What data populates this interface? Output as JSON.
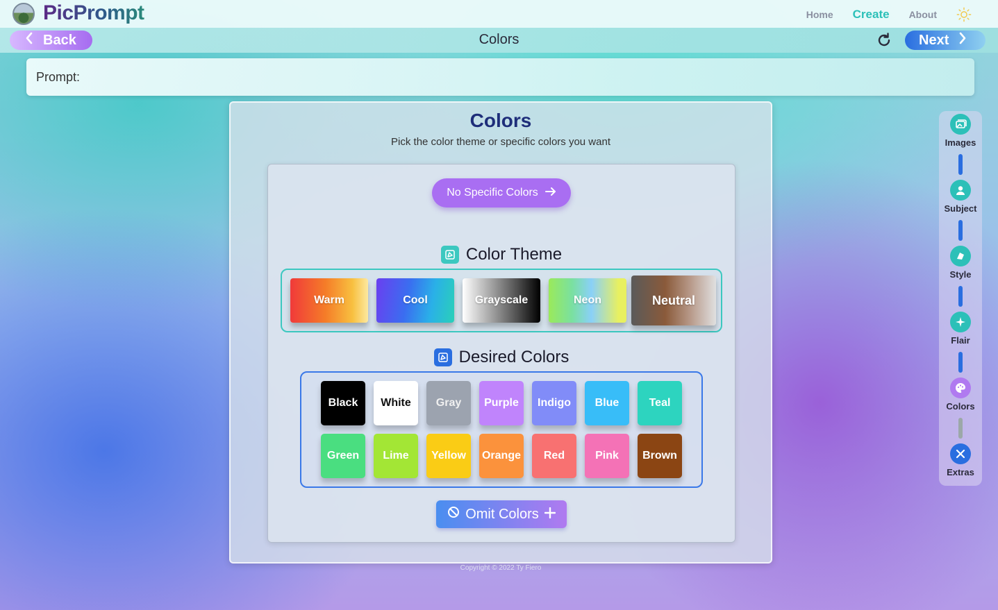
{
  "header": {
    "app_name": "PicPrompt",
    "nav": [
      "Home",
      "Create",
      "About"
    ]
  },
  "toolbar": {
    "back_label": "Back",
    "title": "Colors",
    "next_label": "Next"
  },
  "prompt": {
    "label": "Prompt:"
  },
  "panel": {
    "title": "Colors",
    "subtitle": "Pick the color theme or specific colors you want",
    "no_specific_label": "No Specific Colors",
    "theme_heading": "Color Theme",
    "themes": [
      "Warm",
      "Cool",
      "Grayscale",
      "Neon",
      "Neutral"
    ],
    "desired_heading": "Desired Colors",
    "colors": [
      "Black",
      "White",
      "Gray",
      "Purple",
      "Indigo",
      "Blue",
      "Teal",
      "Green",
      "Lime",
      "Yellow",
      "Orange",
      "Red",
      "Pink",
      "Brown"
    ],
    "color_hex": [
      "#000000",
      "#ffffff",
      "#9ca3af",
      "#c084fc",
      "#818cf8",
      "#38bdf8",
      "#2dd4bf",
      "#4ade80",
      "#a3e635",
      "#facc15",
      "#fb923c",
      "#f87171",
      "#f472b6",
      "#8b4513"
    ],
    "omit_label": "Omit Colors"
  },
  "footer": {
    "copyright": "Copyright © 2022 Ty Fiero"
  },
  "stepper": {
    "steps": [
      "Images",
      "Subject",
      "Style",
      "Flair",
      "Colors",
      "Extras"
    ],
    "icons": [
      "images-icon",
      "user-icon",
      "style-icon",
      "sparkle-icon",
      "palette-icon",
      "tools-icon"
    ],
    "icon_colors": [
      "#2cc0b8",
      "#2cc0b8",
      "#2cc0b8",
      "#2cc0b8",
      "#b07af0",
      "#2a6ee0"
    ]
  },
  "accent_colors": {
    "teal": "#2cc0b8",
    "purple": "#a96ef2",
    "blue": "#2a6ee0",
    "navy": "#1e2e7a"
  }
}
